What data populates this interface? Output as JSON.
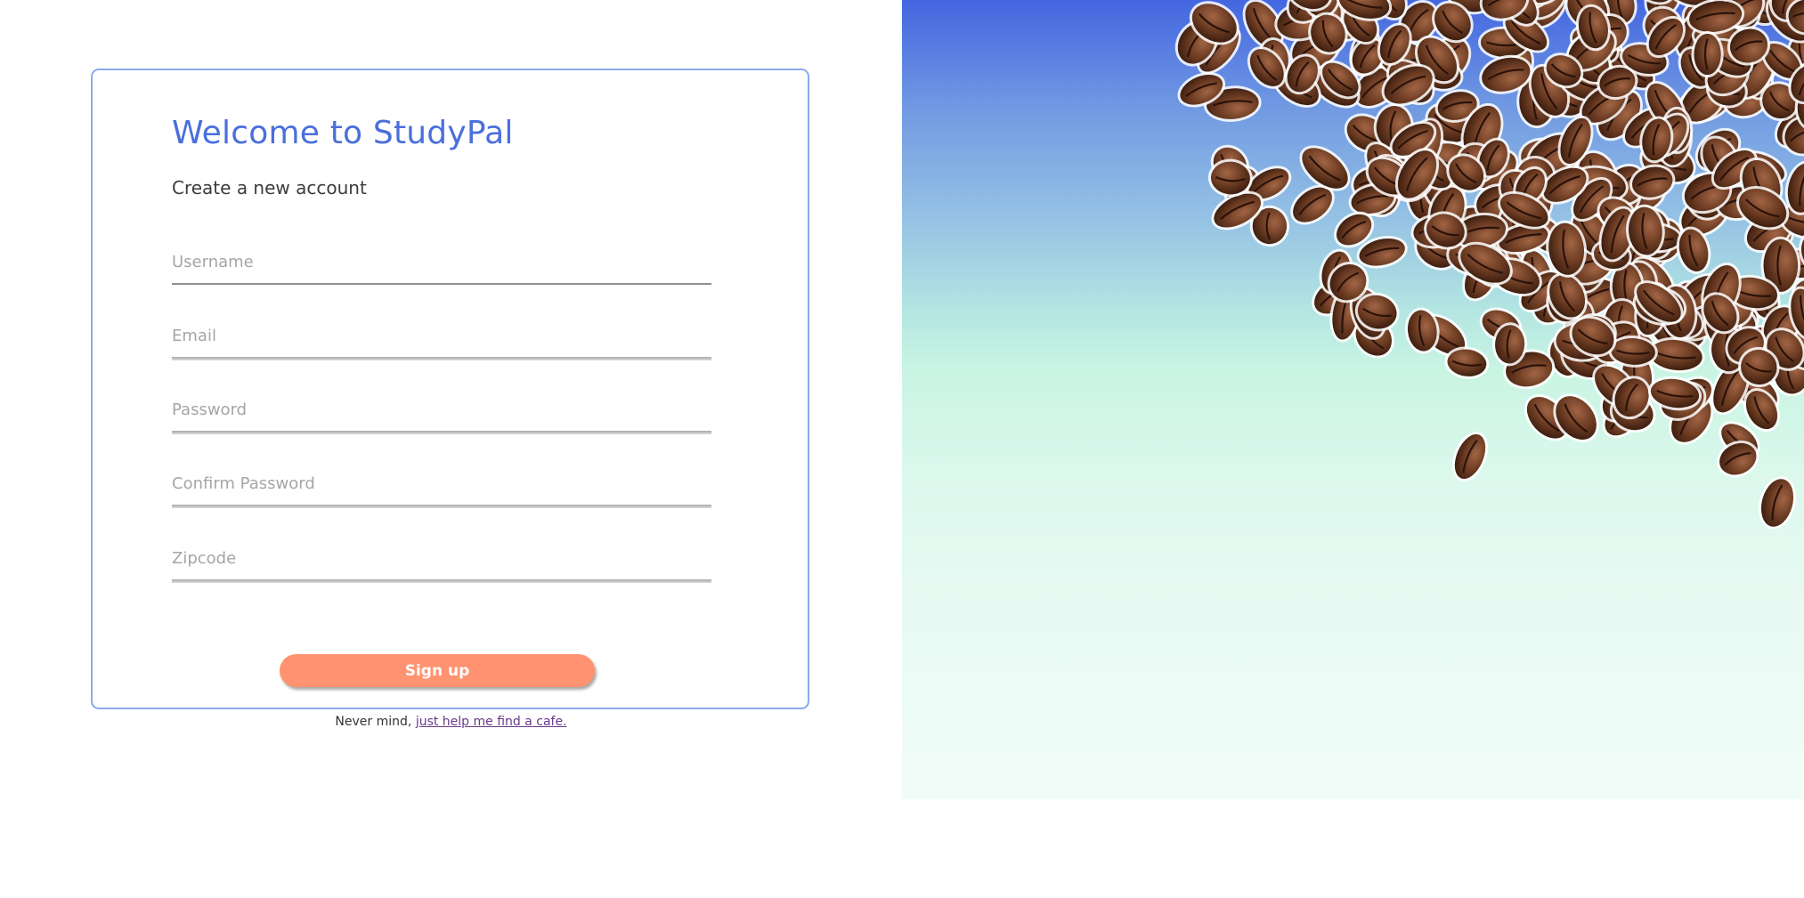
{
  "signup_form": {
    "title": "Welcome to StudyPal",
    "subtitle": "Create a new account",
    "fields": [
      {
        "placeholder": "Username",
        "value": ""
      },
      {
        "placeholder": "Email",
        "value": ""
      },
      {
        "placeholder": "Password",
        "value": ""
      },
      {
        "placeholder": "Confirm Password",
        "value": ""
      },
      {
        "placeholder": "Zipcode",
        "value": ""
      }
    ],
    "submit_label": "Sign up"
  },
  "footer": {
    "prefix": "Never mind, ",
    "link_text": "just help me find a cafe."
  },
  "hero": {
    "image_subject": "coffee-beans",
    "colors": {
      "gradient_top": "#4466e0",
      "gradient_mid": "#c8f4e3",
      "gradient_bottom": "#f1fcf8",
      "bean": "#6b3b22"
    }
  },
  "colors": {
    "accent": "#4a6fdc",
    "button": "#ff9270",
    "card_border": "#8aaaf0",
    "link": "#6a3a8a"
  }
}
